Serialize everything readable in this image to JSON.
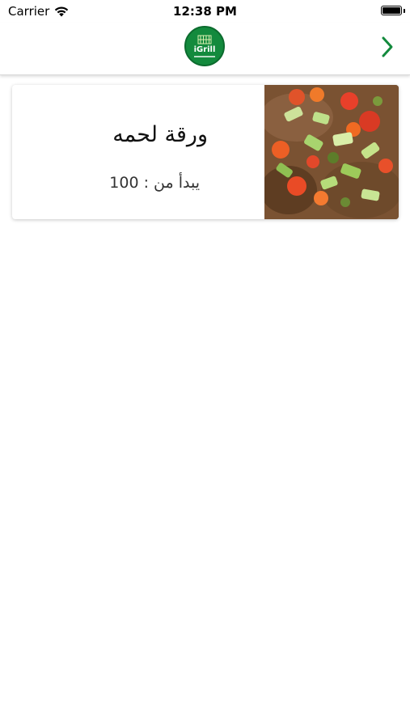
{
  "status_bar": {
    "carrier": "Carrier",
    "time": "12:38 PM",
    "battery_level": 1.0
  },
  "nav_bar": {
    "logo_text": "iGrill",
    "brand_color": "#138a3d",
    "back_icon": "chevron-right-icon"
  },
  "products": [
    {
      "title": "ورقة لحمه",
      "price_label": "يبدأ من : 100",
      "image": "meat-with-vegetables-photo"
    }
  ]
}
